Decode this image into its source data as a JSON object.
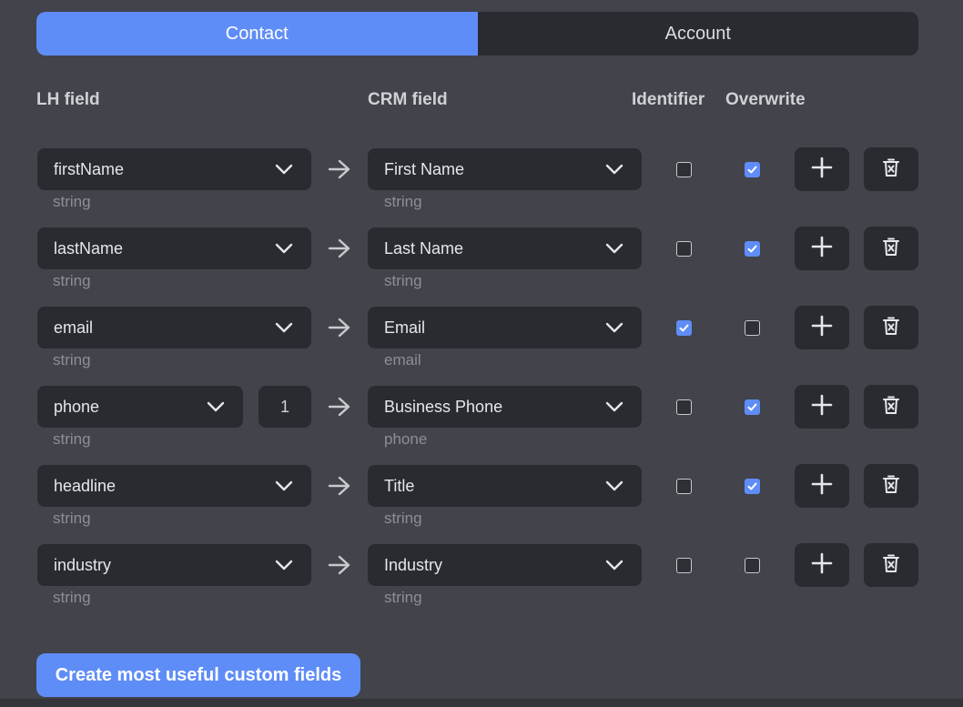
{
  "tabs": [
    {
      "label": "Contact",
      "active": true
    },
    {
      "label": "Account",
      "active": false
    }
  ],
  "headers": {
    "lh_field": "LH field",
    "crm_field": "CRM field",
    "identifier": "Identifier",
    "overwrite": "Overwrite"
  },
  "rows": [
    {
      "lh": "firstName",
      "lh_type": "string",
      "index": "",
      "crm": "First Name",
      "crm_type": "string",
      "identifier": false,
      "overwrite": true
    },
    {
      "lh": "lastName",
      "lh_type": "string",
      "index": "",
      "crm": "Last Name",
      "crm_type": "string",
      "identifier": false,
      "overwrite": true
    },
    {
      "lh": "email",
      "lh_type": "string",
      "index": "",
      "crm": "Email",
      "crm_type": "email",
      "identifier": true,
      "overwrite": false
    },
    {
      "lh": "phone",
      "lh_type": "string",
      "index": "1",
      "crm": "Business Phone",
      "crm_type": "phone",
      "identifier": false,
      "overwrite": true
    },
    {
      "lh": "headline",
      "lh_type": "string",
      "index": "",
      "crm": "Title",
      "crm_type": "string",
      "identifier": false,
      "overwrite": true
    },
    {
      "lh": "industry",
      "lh_type": "string",
      "index": "",
      "crm": "Industry",
      "crm_type": "string",
      "identifier": false,
      "overwrite": false
    }
  ],
  "cta_label": "Create most useful custom fields",
  "icons": {
    "dropdown": "chevron-down-icon",
    "arrow": "arrow-right-icon",
    "add": "plus-icon",
    "delete": "trash-icon",
    "check": "check-icon"
  },
  "colors": {
    "accent": "#5f8df7",
    "background": "#42434b",
    "control": "#2a2b30"
  }
}
